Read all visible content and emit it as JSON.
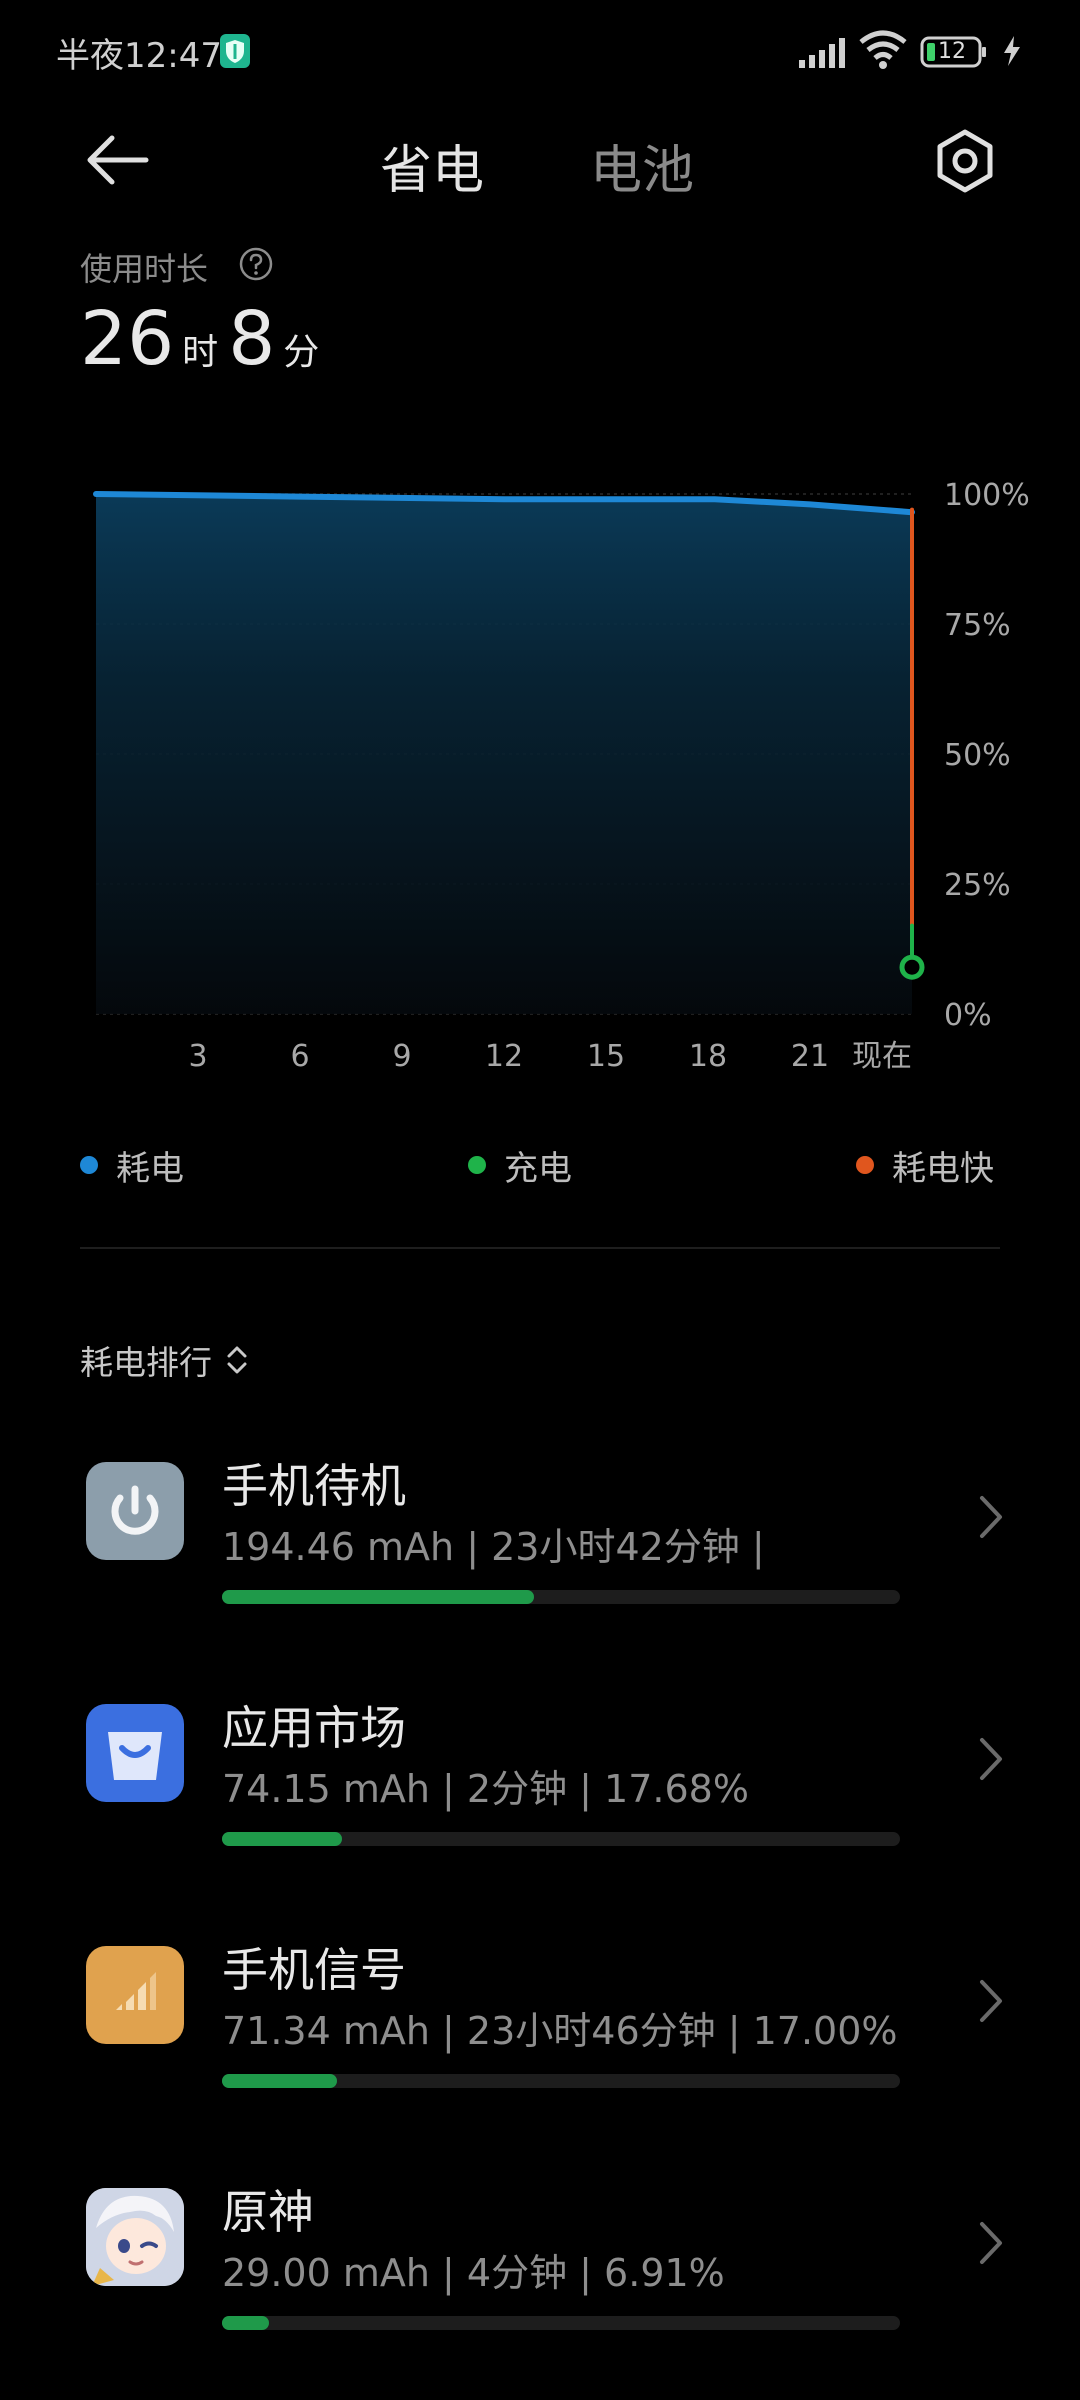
{
  "status_bar": {
    "time": "半夜12:47",
    "battery_level": "12",
    "icons": [
      "shield-icon",
      "signal-icon",
      "wifi-icon",
      "battery-icon",
      "charging-icon"
    ]
  },
  "header": {
    "back_icon": "arrow-left-icon",
    "tabs": [
      {
        "label": "省电",
        "active": true
      },
      {
        "label": "电池",
        "active": false
      }
    ],
    "settings_icon": "gear-icon"
  },
  "usage": {
    "label": "使用时长",
    "hours": "26",
    "hours_unit": "时",
    "minutes": "8",
    "minutes_unit": "分"
  },
  "chart_data": {
    "type": "area",
    "x_tick_labels": [
      "3",
      "6",
      "9",
      "12",
      "15",
      "18",
      "21",
      "现在"
    ],
    "y_tick_labels": [
      "100%",
      "75%",
      "50%",
      "25%",
      "0%"
    ],
    "ylim": [
      0,
      100
    ],
    "x_range_hours": [
      0,
      24
    ],
    "series": [
      {
        "name": "耗电",
        "color": "#1e88d6",
        "points": [
          [
            0,
            100
          ],
          [
            6,
            99.5
          ],
          [
            12,
            99
          ],
          [
            18.2,
            99
          ],
          [
            21,
            98
          ],
          [
            24,
            96.5
          ]
        ]
      },
      {
        "name": "耗电快",
        "color": "#e0561e",
        "points": [
          [
            24,
            97
          ],
          [
            24,
            17
          ]
        ]
      },
      {
        "name": "充电",
        "color": "#1fb34a",
        "points": [
          [
            24,
            17
          ],
          [
            24,
            9
          ]
        ]
      }
    ],
    "current_marker": {
      "x": 24,
      "y": 9,
      "color": "#1fb34a"
    },
    "grid": true,
    "legend_position": "bottom"
  },
  "legend": [
    {
      "label": "耗电",
      "color": "#1e88d6"
    },
    {
      "label": "充电",
      "color": "#1fb34a"
    },
    {
      "label": "耗电快",
      "color": "#e0561e"
    }
  ],
  "ranking": {
    "title": "耗电排行",
    "items": [
      {
        "name": "手机待机",
        "stats": "194.46 mAh | 23小时42分钟 |",
        "share": 0.46,
        "icon": "power-icon",
        "icon_color": "#8c9eab"
      },
      {
        "name": "应用市场",
        "stats": "74.15 mAh | 2分钟 | 17.68%",
        "share": 0.1768,
        "icon": "shopping-bag-icon",
        "icon_color": "#3b6fe0"
      },
      {
        "name": "手机信号",
        "stats": "71.34 mAh | 23小时46分钟 | 17.00%",
        "share": 0.17,
        "icon": "cell-signal-icon",
        "icon_color": "#e0a24e"
      },
      {
        "name": "原神",
        "stats": "29.00 mAh | 4分钟 | 6.91%",
        "share": 0.0691,
        "icon": "game-avatar-icon",
        "icon_color": "#d9dce6"
      }
    ]
  }
}
